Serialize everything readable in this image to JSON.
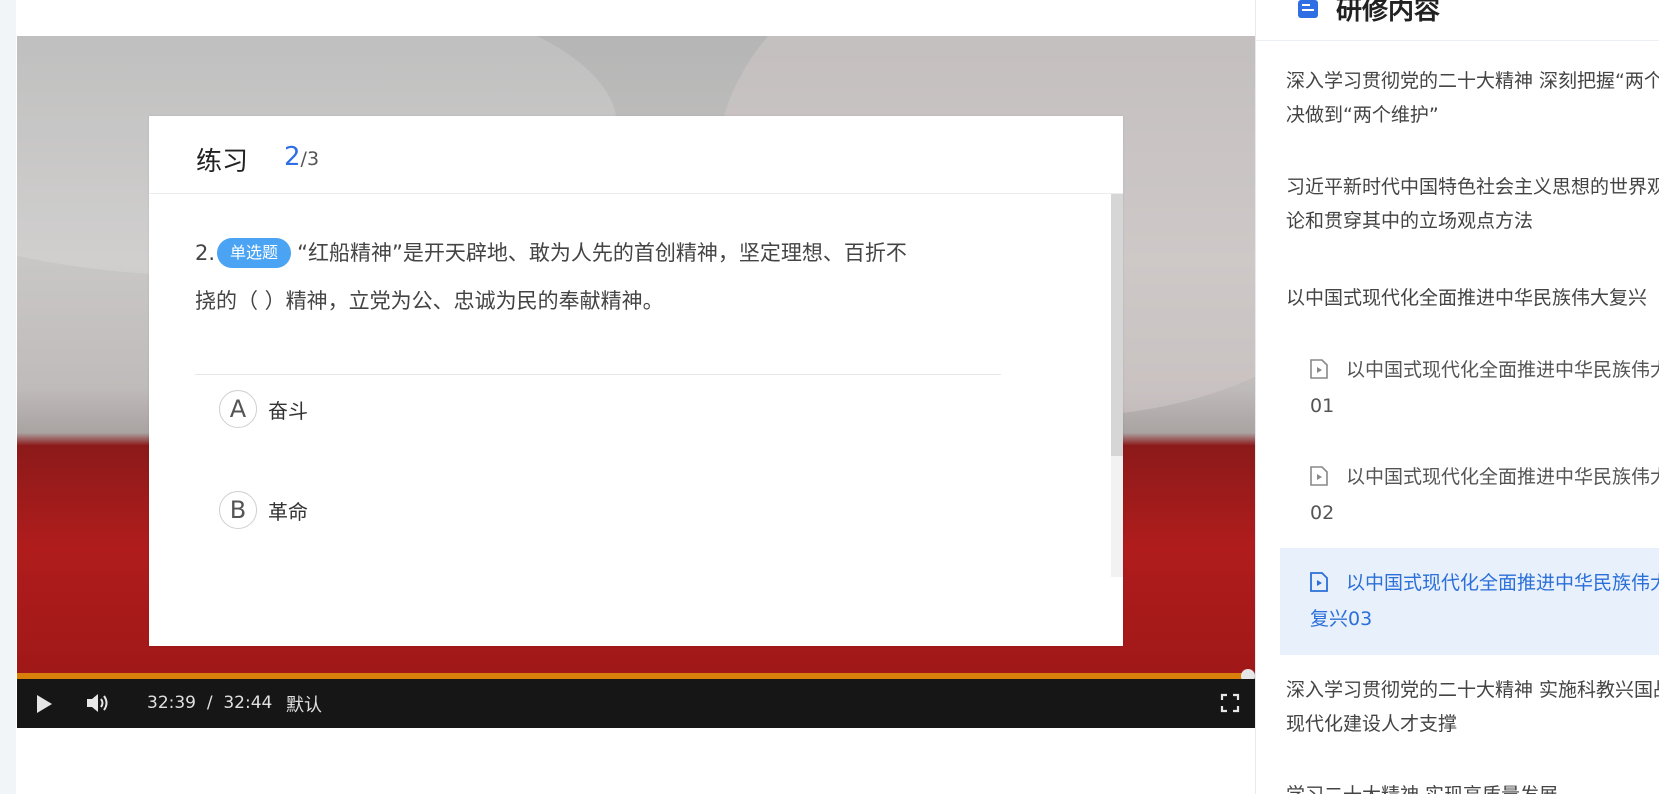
{
  "quiz": {
    "title": "练习",
    "current": "2",
    "total": "/3",
    "question": {
      "number": "2.",
      "type_tag": "单选题",
      "line1": "“红船精神”是开天辟地、敢为人先的首创精神，坚定理想、百折不",
      "line2": "挠的（ ）精神，立党为公、忠诚为民的奉献精神。"
    },
    "options": [
      {
        "letter": "A",
        "text": "奋斗"
      },
      {
        "letter": "B",
        "text": "革命"
      }
    ]
  },
  "player": {
    "time_current": "32:39",
    "time_sep": "/",
    "time_total": "32:44",
    "quality": "默认",
    "progress": 0.998,
    "accent_color": "#d9800b"
  },
  "panel": {
    "title": "研修内容",
    "items": [
      {
        "line1": "深入学习贯彻党的二十大精神 深刻把握“两个确立”的决定性意义 坚",
        "line2": "决做到“两个维护”"
      },
      {
        "line1": "习近平新时代中国特色社会主义思想的世界观和方法论和贯穿其中的立场观点方法",
        "line2": "论和贯穿其中的立场观点方法"
      },
      {
        "line1": "以中国式现代化全面推进中华民族伟大复兴"
      }
    ],
    "subs": [
      {
        "line1": "以中国式现代化全面推进中华民族伟大复兴",
        "line2": "01",
        "active": false
      },
      {
        "line1": "以中国式现代化全面推进中华民族伟大复兴",
        "line2": "02",
        "active": false
      },
      {
        "line1": "以中国式现代化全面推进中华民族伟大",
        "line2": "复兴03",
        "active": true
      }
    ],
    "items2": [
      {
        "line1": "深入学习贯彻党的二十大精神 实施科教兴国战略 为全面建设社会主义",
        "line2": "现代化建设人才支撑"
      },
      {
        "line1": "学习二十大精神 实现高质量发展"
      }
    ]
  }
}
